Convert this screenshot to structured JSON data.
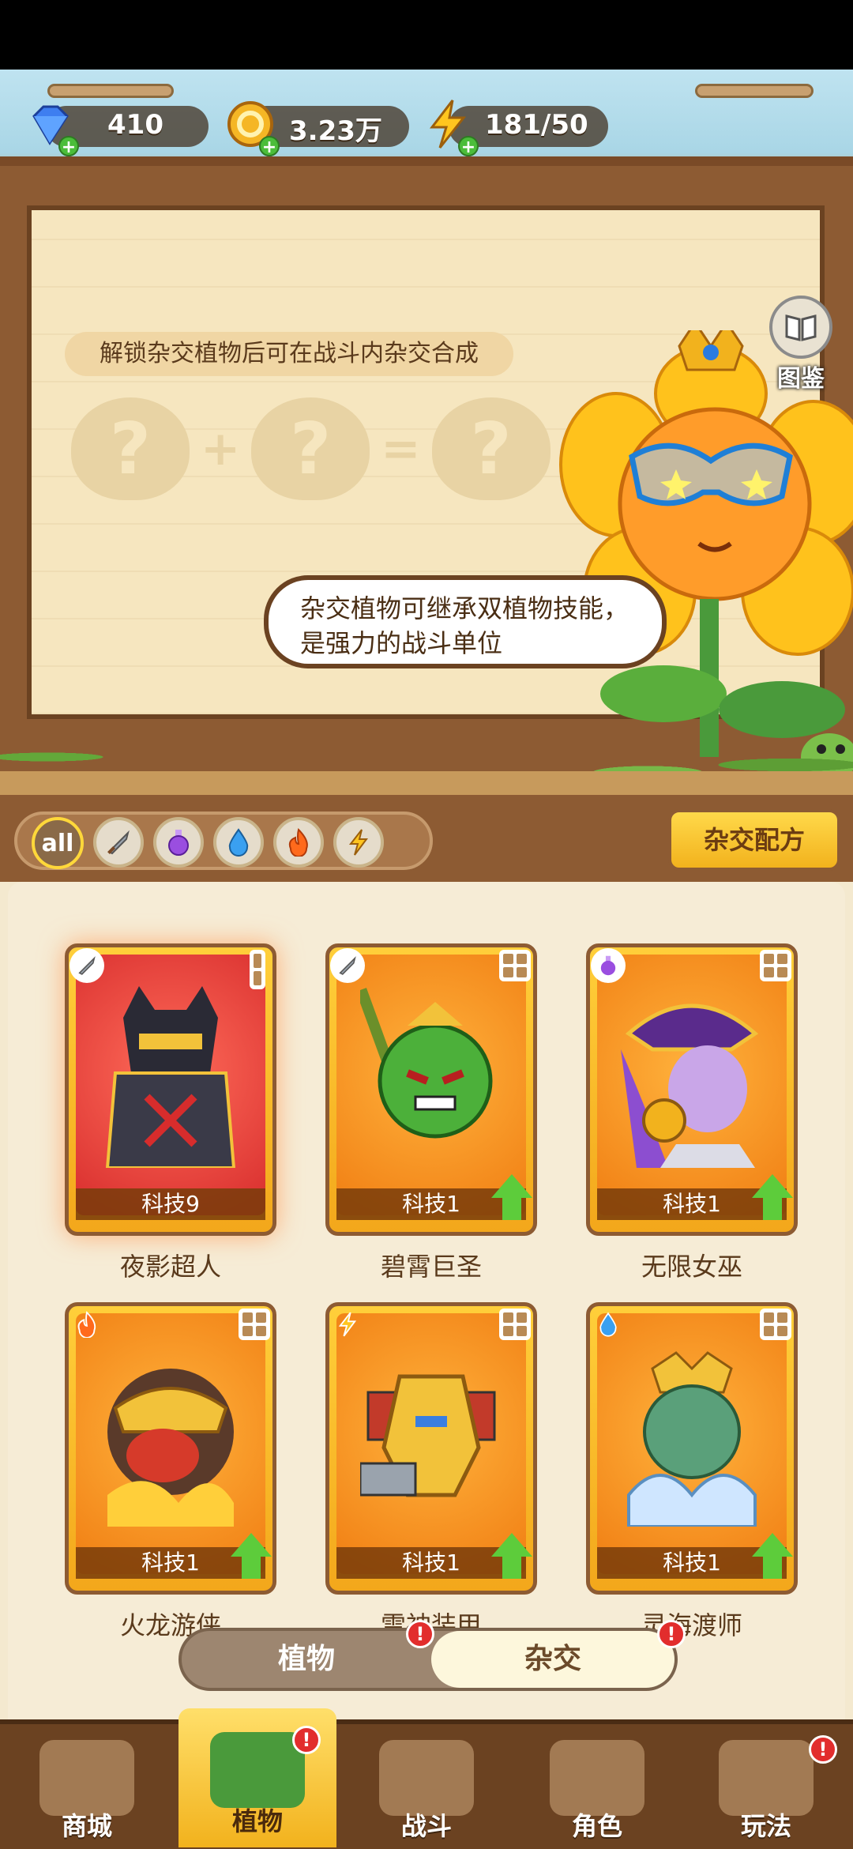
{
  "resources": {
    "gems": "410",
    "coins": "3.23万",
    "energy": "181/50"
  },
  "banner": {
    "hint": "解锁杂交植物后可在战斗内杂交合成",
    "atlas_label": "图鉴",
    "speech": "杂交植物可继承双植物技能，是强力的战斗单位"
  },
  "filters": {
    "all_label": "all",
    "icons": [
      "sword-icon",
      "potion-icon",
      "water-drop-icon",
      "fire-icon",
      "lightning-icon"
    ]
  },
  "recipe_button": "杂交配方",
  "cards": [
    {
      "name": "夜影超人",
      "tech": "科技9",
      "element": "sword-icon",
      "selected": true
    },
    {
      "name": "碧霄巨圣",
      "tech": "科技1",
      "element": "sword-icon",
      "selected": false
    },
    {
      "name": "无限女巫",
      "tech": "科技1",
      "element": "potion-icon",
      "selected": false
    },
    {
      "name": "火龙游侠",
      "tech": "科技1",
      "element": "fire-icon",
      "selected": false
    },
    {
      "name": "雷神装甲",
      "tech": "科技1",
      "element": "lightning-icon",
      "selected": false
    },
    {
      "name": "灵海渡师",
      "tech": "科技1",
      "element": "water-drop-icon",
      "selected": false
    }
  ],
  "segment": {
    "left": "植物",
    "right": "杂交",
    "badge": "!"
  },
  "nav": [
    {
      "label": "商城"
    },
    {
      "label": "植物"
    },
    {
      "label": "战斗"
    },
    {
      "label": "角色"
    },
    {
      "label": "玩法"
    }
  ],
  "colors": {
    "wood": "#8d5b33",
    "gold": "#f2b21d",
    "alert": "#e22d2d",
    "upgrade": "#5dcc3b"
  }
}
